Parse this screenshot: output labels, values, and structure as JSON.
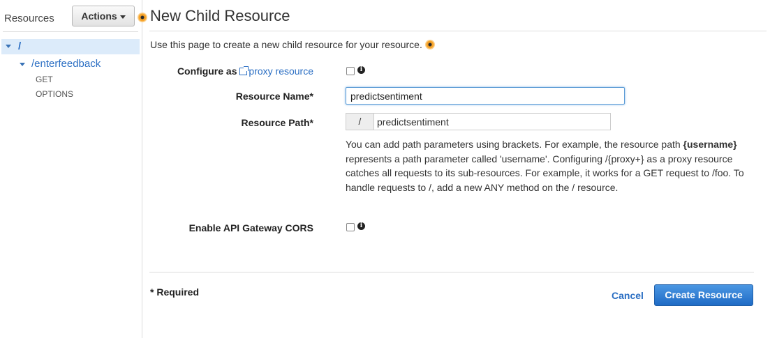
{
  "sidebar": {
    "title": "Resources",
    "actions_label": "Actions",
    "tree": {
      "root": "/",
      "child": "/enterfeedback",
      "methods": [
        "GET",
        "OPTIONS"
      ]
    }
  },
  "main": {
    "title": "New Child Resource",
    "description": "Use this page to create a new child resource for your resource.",
    "form": {
      "configure_prefix": "Configure as",
      "proxy_link": "proxy resource",
      "resource_name_label": "Resource Name*",
      "resource_name_value": "predictsentiment",
      "resource_path_label": "Resource Path*",
      "resource_path_prefix": "/",
      "resource_path_value": "predictsentiment",
      "help_1": "You can add path parameters using brackets. For example, the resource path ",
      "help_bold": "{username}",
      "help_2": " represents a path parameter called 'username'. Configuring /{proxy+} as a proxy resource catches all requests to its sub-resources. For example, it works for a GET request to /foo. To handle requests to /, add a new ANY method on the / resource.",
      "cors_label": "Enable API Gateway CORS",
      "info_glyph": "i"
    },
    "footer": {
      "required": "* Required",
      "cancel": "Cancel",
      "create": "Create Resource"
    }
  },
  "colors": {
    "link": "#2a6ec3",
    "primary_button": "#1f6bc5",
    "selected_row": "#dcebfa"
  }
}
